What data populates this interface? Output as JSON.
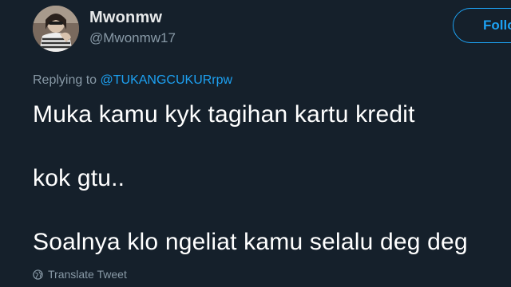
{
  "author": {
    "display_name": "Mwonmw",
    "handle": "@Mwonmw17",
    "follow_label": "Follo"
  },
  "reply": {
    "prefix": "Replying to ",
    "mention": "@TUKANGCUKURrpw"
  },
  "tweet": {
    "lines": [
      "Muka kamu kyk tagihan kartu kredit",
      "kok gtu..",
      "Soalnya klo ngeliat kamu selalu deg deg"
    ]
  },
  "translate": {
    "icon": "globe-icon",
    "label": "Translate Tweet"
  },
  "colors": {
    "background": "#15202b",
    "accent": "#1da1f2",
    "secondary_text": "#8899a6",
    "primary_text": "#ffffff"
  }
}
